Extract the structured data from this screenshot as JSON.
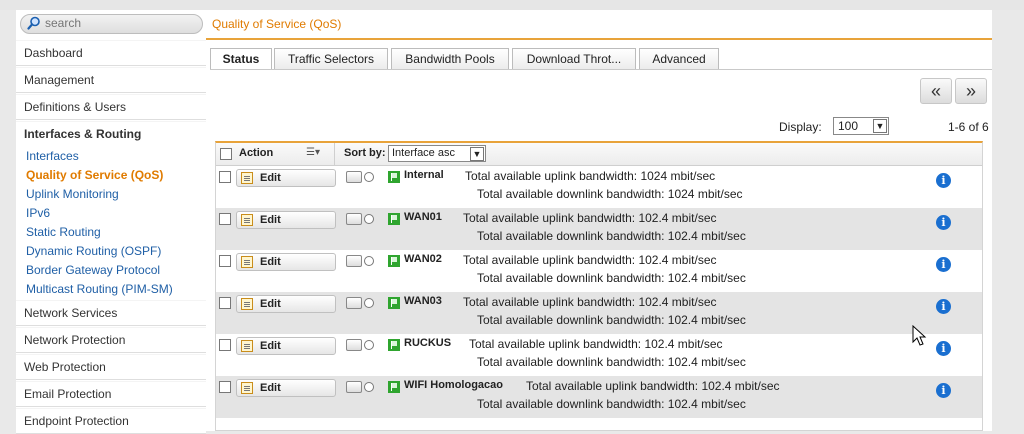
{
  "search": {
    "placeholder": "search"
  },
  "sidebar": {
    "items": [
      {
        "label": "Dashboard"
      },
      {
        "label": "Management"
      },
      {
        "label": "Definitions & Users"
      },
      {
        "label": "Interfaces & Routing"
      },
      {
        "label": "Network Services"
      },
      {
        "label": "Network Protection"
      },
      {
        "label": "Web Protection"
      },
      {
        "label": "Email Protection"
      },
      {
        "label": "Endpoint Protection"
      }
    ],
    "subitems": [
      {
        "label": "Interfaces"
      },
      {
        "label": "Quality of Service (QoS)"
      },
      {
        "label": "Uplink Monitoring"
      },
      {
        "label": "IPv6"
      },
      {
        "label": "Static Routing"
      },
      {
        "label": "Dynamic Routing (OSPF)"
      },
      {
        "label": "Border Gateway Protocol"
      },
      {
        "label": "Multicast Routing (PIM-SM)"
      }
    ]
  },
  "page": {
    "title": "Quality of Service (QoS)"
  },
  "tabs": [
    {
      "label": "Status"
    },
    {
      "label": "Traffic Selectors"
    },
    {
      "label": "Bandwidth Pools"
    },
    {
      "label": "Download Throt..."
    },
    {
      "label": "Advanced"
    }
  ],
  "pagination": {
    "prev": "«",
    "next": "»",
    "display_label": "Display:",
    "display_value": "100",
    "range": "1-6 of 6"
  },
  "table": {
    "action_header": "Action",
    "sort_label": "Sort by:",
    "sort_value": "Interface asc",
    "edit_label": "Edit",
    "info_glyph": "i",
    "rows": [
      {
        "name": "Internal",
        "uplink": "Total available uplink bandwidth: 1024 mbit/sec",
        "downlink": "Total available downlink bandwidth: 1024 mbit/sec"
      },
      {
        "name": "WAN01",
        "uplink": "Total available uplink bandwidth: 102.4 mbit/sec",
        "downlink": "Total available downlink bandwidth: 102.4 mbit/sec"
      },
      {
        "name": "WAN02",
        "uplink": "Total available uplink bandwidth: 102.4 mbit/sec",
        "downlink": "Total available downlink bandwidth: 102.4 mbit/sec"
      },
      {
        "name": "WAN03",
        "uplink": "Total available uplink bandwidth: 102.4 mbit/sec",
        "downlink": "Total available downlink bandwidth: 102.4 mbit/sec"
      },
      {
        "name": "RUCKUS",
        "uplink": "Total available uplink bandwidth: 102.4 mbit/sec",
        "downlink": "Total available downlink bandwidth: 102.4 mbit/sec"
      },
      {
        "name": "WIFI Homologacao",
        "uplink": "Total available uplink bandwidth: 102.4 mbit/sec",
        "downlink": "Total available downlink bandwidth: 102.4 mbit/sec"
      }
    ]
  },
  "colors": {
    "accent": "#e8a33a",
    "active_link": "#e07b00",
    "link": "#1f5fa6",
    "info": "#1a6fd0",
    "flag": "#2fa52f"
  }
}
